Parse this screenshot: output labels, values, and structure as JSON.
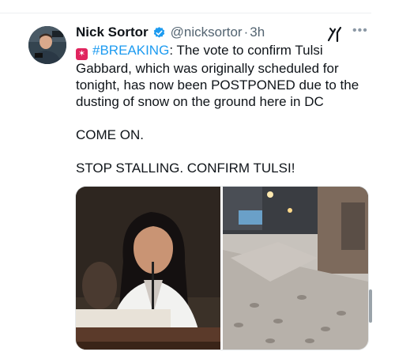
{
  "tweet": {
    "author_name": "Nick Sortor",
    "handle": "@nicksortor",
    "separator": "·",
    "time": "3h",
    "verified": true,
    "icons": {
      "avatar": "avatar",
      "verified": "verified-badge-icon",
      "grok": "grok-icon",
      "more": "more-options-icon",
      "emoji": "siren-emoji-icon"
    },
    "text": {
      "hashtag": "#BREAKING",
      "para1_rest": ": The vote to confirm Tulsi Gabbard, which was originally scheduled for tonight, has now been POSTPONED due to the dusting of snow on the ground here in DC",
      "para2": "COME ON.",
      "para3": "STOP STALLING. CONFIRM TULSI!"
    },
    "media": [
      {
        "name": "photo-tulsi-gabbard"
      },
      {
        "name": "photo-snowy-sidewalk"
      }
    ]
  },
  "colors": {
    "link": "#1d9bf0",
    "verified": "#1d9bf0",
    "muted": "#536471"
  }
}
